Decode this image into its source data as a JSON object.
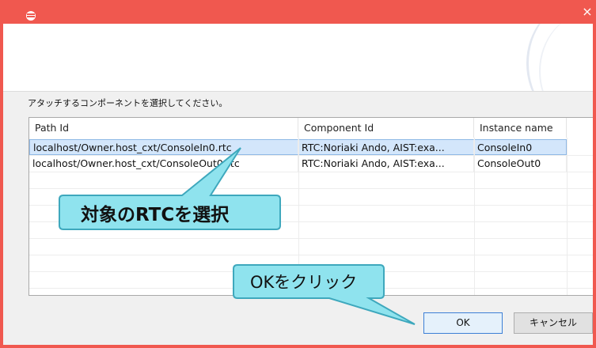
{
  "window": {
    "title": "",
    "close_label": "×"
  },
  "instruction": "アタッチするコンポーネントを選択してください。",
  "table": {
    "columns": [
      "Path Id",
      "Component Id",
      "Instance name"
    ],
    "rows": [
      {
        "path_id": "localhost/Owner.host_cxt/ConsoleIn0.rtc",
        "component_id": "RTC:Noriaki Ando, AIST:exa...",
        "instance_name": "ConsoleIn0",
        "selected": true
      },
      {
        "path_id": "localhost/Owner.host_cxt/ConsoleOut0.rtc",
        "component_id": "RTC:Noriaki Ando, AIST:exa...",
        "instance_name": "ConsoleOut0",
        "selected": false
      }
    ]
  },
  "callouts": {
    "select_rtc": "対象のRTCを選択",
    "click_ok": "OKをクリック"
  },
  "buttons": {
    "ok": "OK",
    "cancel": "キャンセル"
  },
  "colors": {
    "titlebar": "#f0584f",
    "selection": "#d3e6fb",
    "callout_fill": "#8fe3ee",
    "callout_stroke": "#3ea8bd"
  },
  "icons": {
    "app": "eclipse-icon",
    "close": "close-icon"
  }
}
